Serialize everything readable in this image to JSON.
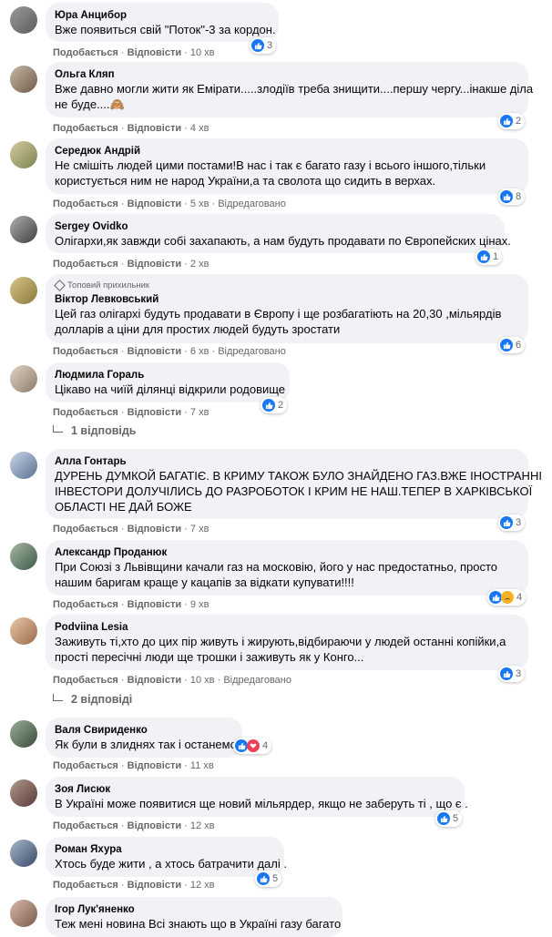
{
  "actions": {
    "like": "Подобається",
    "reply": "Відповісти",
    "edited": "Відредаговано",
    "sep": "·"
  },
  "badge": {
    "top_fan": "Топовий прихильник"
  },
  "comments": [
    {
      "name": "Юра Анцибор",
      "lines": [
        "Вже появиться свій \"Поток\"-3 за кордон."
      ],
      "time": "10 хв",
      "reactions": "3"
    },
    {
      "name": "Ольга Кляп",
      "lines": [
        "Вже давно могли жити як Емірати.....злодіїв треба знищити....першу чергу...інакше діла",
        "не буде....🙈"
      ],
      "time": "4 хв",
      "reactions": "2"
    },
    {
      "name": "Середюк Андрій",
      "lines": [
        "Не смішіть людей цими постами!В нас і так є багато газу і всього іншого,тільки",
        "користується ним не народ України,а та сволота що сидить в верхах."
      ],
      "time": "5 хв",
      "reactions": "8"
    },
    {
      "name": "Sergey Ovidko",
      "lines": [
        "Олігархи,як завжди собі захапають, а нам будуть продавати по Європейских цінах."
      ],
      "time": "2 хв",
      "reactions": "1"
    },
    {
      "name": "Віктор Левковський",
      "lines": [
        "Цей газ олігархі будуть продавати в Європу і ще розбагатіють на 20,30 ,мільярдів",
        "долларів а ціни для простих людей будуть зростати"
      ],
      "time": "6 хв",
      "reactions": "6"
    },
    {
      "name": "Людмила Гораль",
      "lines": [
        "Цікаво на чиїй ділянці відкрили родовище"
      ],
      "time": "7 хв",
      "reactions": "2"
    },
    {
      "name": "Алла Гонтарь",
      "lines": [
        "ДУРЕНЬ ДУМКОЙ БАГАТІЄ. В КРИМУ ТАКОЖ БУЛО ЗНАЙДЕНО ГАЗ.ВЖЕ ІНОСТРАННІ",
        "ІНВЕСТОРИ ДОЛУЧІЛИСЬ ДО РАЗРОБОТОК І КРИМ НЕ НАШ.ТЕПЕР В ХАРКІВСЬКОЇ",
        "ОБЛАСТІ НЕ ДАЙ БОЖЕ"
      ],
      "time": "7 хв",
      "reactions": "3"
    },
    {
      "name": "Александр Проданюк",
      "lines": [
        "При Союзі з Львівщини качали газ на московію, його у нас предостатньо, просто",
        "нашим баригам краще у кацапів за відкати купувати!!!!"
      ],
      "time": "9 хв",
      "reactions": "4"
    },
    {
      "name": "Podviina Lesia",
      "lines": [
        "Заживуть ті,хто до цих пір живуть і жирують,відбираючи у людей останні копійки,а",
        "прості пересічні люди ще трошки і заживуть як у Конго..."
      ],
      "time": "10 хв",
      "reactions": "3"
    },
    {
      "name": "Валя Свириденко",
      "lines": [
        "Як були в злиднях так і останемся"
      ],
      "time": "11 хв",
      "reactions": "4"
    },
    {
      "name": "Зоя Лисюк",
      "lines": [
        "В Україні може появитися ще новий мільярдер, якщо не заберуть ті , що є ."
      ],
      "time": "12 хв",
      "reactions": "5"
    },
    {
      "name": "Роман Яхура",
      "lines": [
        "Хтось буде жити , а хтось батрачити далі ."
      ],
      "time": "12 хв",
      "reactions": "5"
    },
    {
      "name": "Ігор Лук'яненко",
      "lines": [
        "Теж мені новина Всі знають що в Україні газу багато"
      ]
    }
  ],
  "replies": [
    {
      "label": "1 відповідь"
    },
    {
      "label": "2 відповіді"
    }
  ],
  "colors": {
    "like_blue": "#1877f2",
    "heart_red": "#f33e58",
    "sad_yellow": "#f7b125",
    "bubble_bg": "#f0f2f5",
    "meta_grey": "#65676b"
  }
}
